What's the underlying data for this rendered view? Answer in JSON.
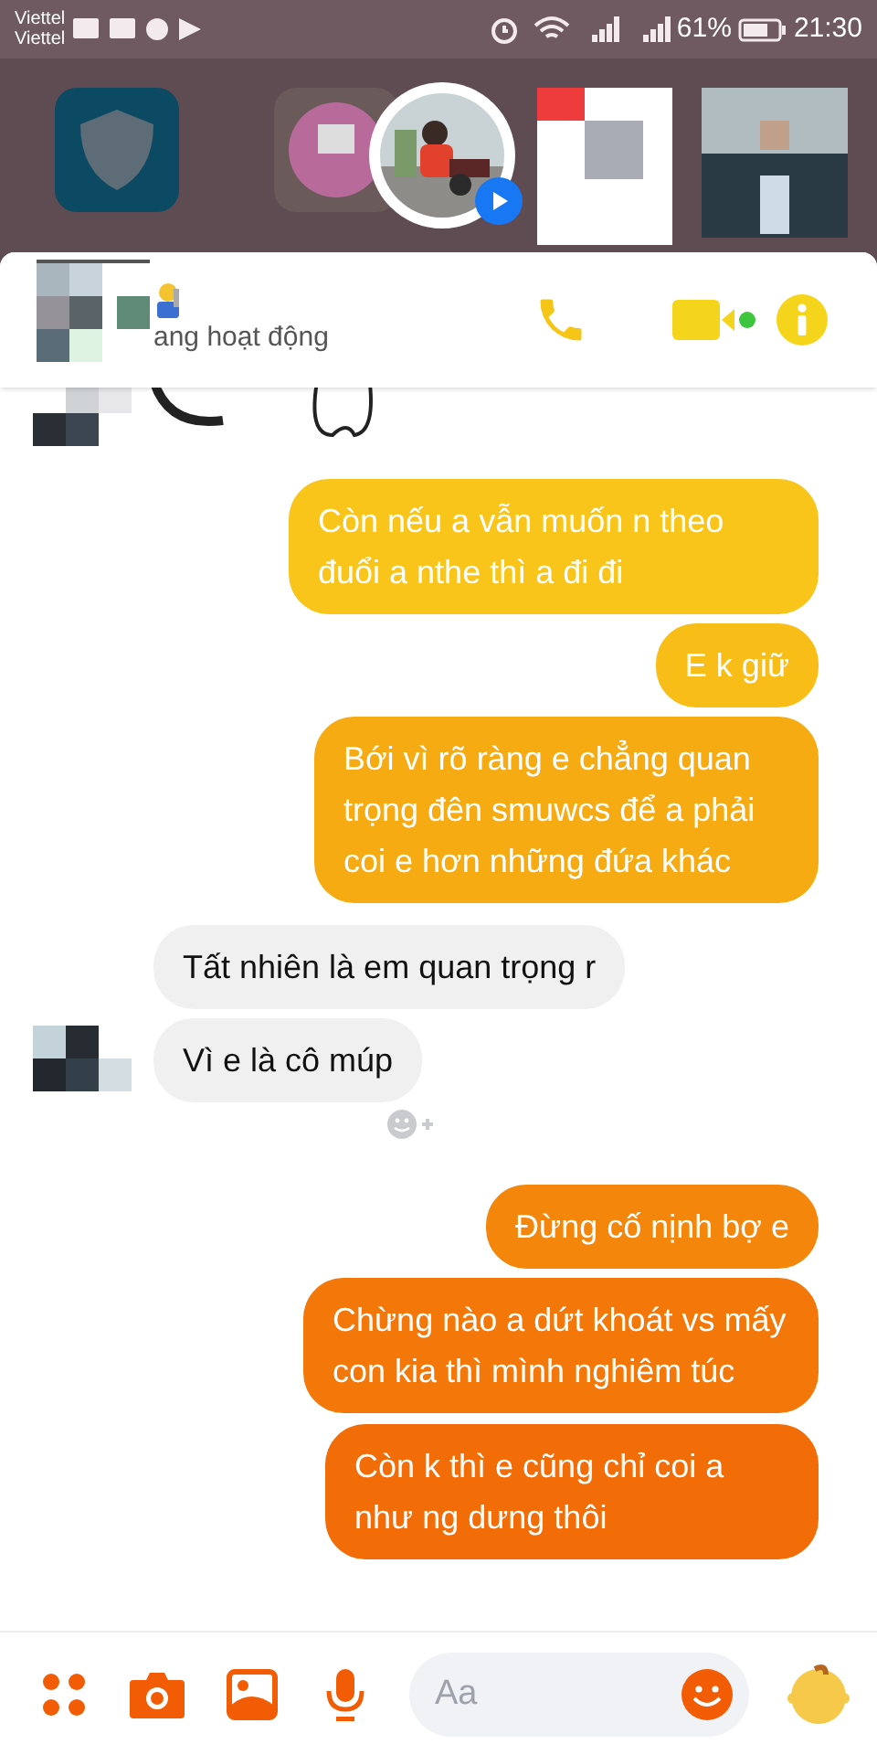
{
  "status_bar": {
    "carriers": [
      "Viettel",
      "Viettel"
    ],
    "battery": "61%",
    "time": "21:30"
  },
  "chat_header": {
    "status": "ang hoạt động"
  },
  "messages": [
    {
      "kind": "sent",
      "text": "Còn nếu a vẫn muốn n theo đuổi a nthe thì a đi đi"
    },
    {
      "kind": "sent",
      "text": "E k giữ"
    },
    {
      "kind": "sent",
      "text": "Bới vì rõ ràng e chẳng quan trọng đên smuwcs để a phải coi e hơn những đứa khác"
    },
    {
      "kind": "received",
      "text": "Tất nhiên là em quan trọng r"
    },
    {
      "kind": "received",
      "text": "Vì e là cô múp"
    },
    {
      "kind": "sent",
      "text": "Đừng cố nịnh bợ e"
    },
    {
      "kind": "sent",
      "text": "Chừng nào a dứt khoát vs mấy con kia thì mình nghiêm túc"
    },
    {
      "kind": "sent",
      "text": "Còn k thì e cũng chỉ coi a như ng dưng thôi"
    }
  ],
  "composer": {
    "placeholder": "Aa"
  }
}
